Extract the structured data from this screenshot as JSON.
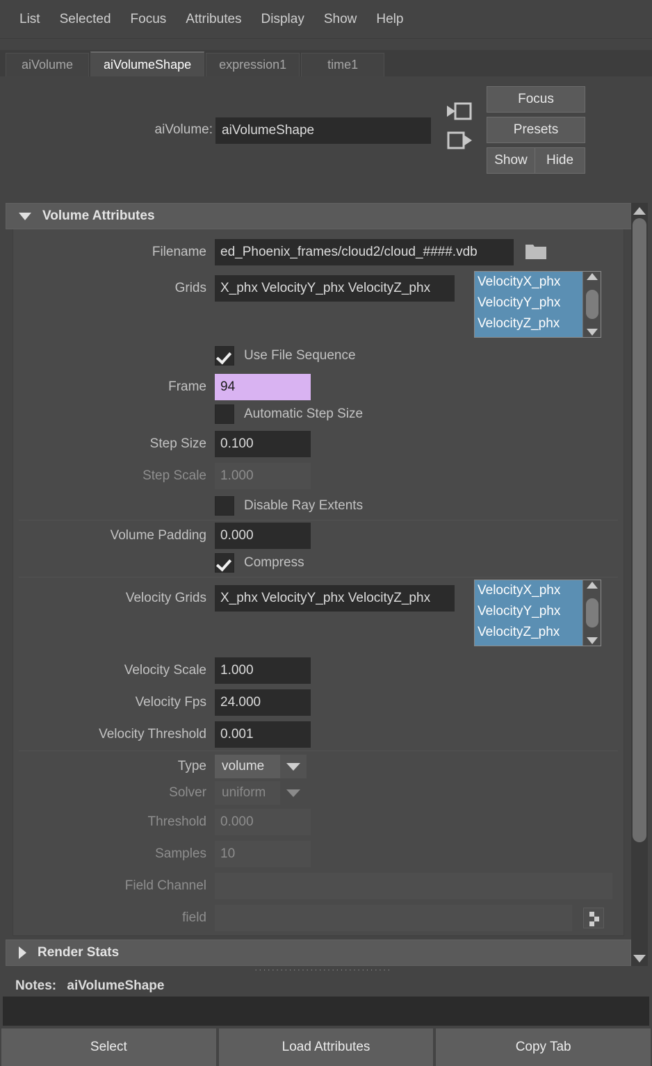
{
  "menubar": {
    "items": [
      {
        "label": "List"
      },
      {
        "label": "Selected"
      },
      {
        "label": "Focus"
      },
      {
        "label": "Attributes"
      },
      {
        "label": "Display"
      },
      {
        "label": "Show"
      },
      {
        "label": "Help"
      }
    ]
  },
  "tabs": [
    {
      "label": "aiVolume",
      "active": false
    },
    {
      "label": "aiVolumeShape",
      "active": true
    },
    {
      "label": "expression1",
      "active": false
    },
    {
      "label": "time1",
      "active": false
    }
  ],
  "header": {
    "node_type_label": "aiVolume:",
    "node_name_value": "aiVolumeShape",
    "focus_button": "Focus",
    "presets_button": "Presets",
    "show_button": "Show",
    "hide_button": "Hide",
    "input_connection_icon": "input-connection-icon",
    "output_connection_icon": "output-connection-icon"
  },
  "volume_attributes": {
    "section_title": "Volume Attributes",
    "expanded": true,
    "filename": {
      "label": "Filename",
      "value": "ed_Phoenix_frames/cloud2/cloud_####.vdb",
      "browse_icon": "folder-icon"
    },
    "grids": {
      "label": "Grids",
      "value": "X_phx VelocityY_phx VelocityZ_phx",
      "list_items": [
        "VelocityX_phx",
        "VelocityY_phx",
        "VelocityZ_phx"
      ],
      "selected": [
        "VelocityX_phx",
        "VelocityY_phx",
        "VelocityZ_phx"
      ]
    },
    "use_file_sequence": {
      "label": "Use File Sequence",
      "checked": true
    },
    "frame": {
      "label": "Frame",
      "value": "94",
      "expression_driven": true
    },
    "automatic_step_size": {
      "label": "Automatic Step Size",
      "checked": false
    },
    "step_size": {
      "label": "Step Size",
      "value": "0.100",
      "enabled": true
    },
    "step_scale": {
      "label": "Step Scale",
      "value": "1.000",
      "enabled": false
    },
    "disable_ray_extents": {
      "label": "Disable Ray Extents",
      "checked": false
    },
    "volume_padding": {
      "label": "Volume Padding",
      "value": "0.000",
      "enabled": true
    },
    "compress": {
      "label": "Compress",
      "checked": true
    },
    "velocity_grids": {
      "label": "Velocity Grids",
      "value": "X_phx VelocityY_phx VelocityZ_phx",
      "list_items": [
        "VelocityX_phx",
        "VelocityY_phx",
        "VelocityZ_phx"
      ],
      "selected": [
        "VelocityX_phx",
        "VelocityY_phx",
        "VelocityZ_phx"
      ]
    },
    "velocity_scale": {
      "label": "Velocity Scale",
      "value": "1.000",
      "enabled": true
    },
    "velocity_fps": {
      "label": "Velocity Fps",
      "value": "24.000",
      "enabled": true
    },
    "velocity_threshold": {
      "label": "Velocity Threshold",
      "value": "0.001",
      "enabled": true
    },
    "type": {
      "label": "Type",
      "value": "volume",
      "enabled": true
    },
    "solver": {
      "label": "Solver",
      "value": "uniform",
      "enabled": false
    },
    "threshold": {
      "label": "Threshold",
      "value": "0.000",
      "enabled": false
    },
    "samples": {
      "label": "Samples",
      "value": "10",
      "enabled": false
    },
    "field_channel": {
      "label": "Field Channel",
      "value": "",
      "enabled": false
    },
    "field": {
      "label": "field",
      "value": "",
      "enabled": false,
      "map_icon": "checker-map-icon"
    }
  },
  "render_stats": {
    "section_title": "Render Stats",
    "expanded": false
  },
  "notes": {
    "label": "Notes:",
    "value": "aiVolumeShape",
    "text": ""
  },
  "bottom_buttons": [
    {
      "label": "Select"
    },
    {
      "label": "Load Attributes"
    },
    {
      "label": "Copy Tab"
    }
  ],
  "colors": {
    "panel_bg": "#444444",
    "field_bg": "#2b2b2b",
    "selection_blue": "#5b8fb3",
    "expression_purple": "#d9b3f2",
    "section_header": "#5a5a5a"
  }
}
